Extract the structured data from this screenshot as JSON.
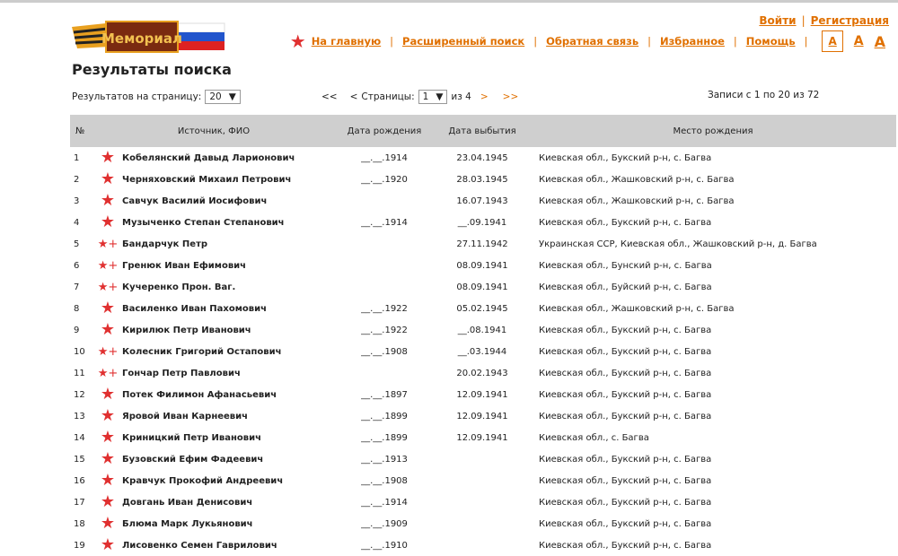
{
  "logo": {
    "text": "Мемориал"
  },
  "auth": {
    "login": "Войти",
    "register": "Регистрация"
  },
  "nav": [
    {
      "label": "На главную"
    },
    {
      "label": "Расширенный поиск"
    },
    {
      "label": "Обратная связь"
    },
    {
      "label": "Избранное"
    },
    {
      "label": "Помощь"
    }
  ],
  "font_sizes": [
    "A",
    "A",
    "A"
  ],
  "title": "Результаты поиска",
  "per_page": {
    "label": "Результатов на страницу:",
    "value": "20"
  },
  "pager": {
    "first": "<<",
    "prev": "<",
    "label": "Страницы:",
    "page": "1",
    "of": "из 4",
    "next": ">",
    "last": ">>"
  },
  "records": "Записи с 1 по 20 из 72",
  "columns": [
    "№",
    "Источник, ФИО",
    "Дата рождения",
    "Дата выбытия",
    "Место рождения"
  ],
  "rows": [
    [
      "1",
      "big",
      "Кобелянский Давыд Ларионович",
      "__.__.1914",
      "23.04.1945",
      "Киевская обл., Букский р-н, с. Багва"
    ],
    [
      "2",
      "big",
      "Черняховский Михаил Петрович",
      "__.__.1920",
      "28.03.1945",
      "Киевская обл., Жашковский р-н, с. Багва"
    ],
    [
      "3",
      "big",
      "Савчук Василий Иосифович",
      "",
      "16.07.1943",
      "Киевская обл., Жашковский р-н, с. Багва"
    ],
    [
      "4",
      "big",
      "Музыченко Степан Степанович",
      "__.__.1914",
      "__.09.1941",
      "Киевская обл., Букский р-н, с. Багва"
    ],
    [
      "5",
      "small",
      "Бандарчук Петр",
      "",
      "27.11.1942",
      "Украинская ССР, Киевская обл., Жашковский р-н, д. Багва"
    ],
    [
      "6",
      "small",
      "Гренюк Иван Ефимович",
      "",
      "08.09.1941",
      "Киевская обл., Бунский р-н, с. Багва"
    ],
    [
      "7",
      "small",
      "Кучеренко Прон. Ваг.",
      "",
      "08.09.1941",
      "Киевская обл., Буйский р-н, с. Багва"
    ],
    [
      "8",
      "big",
      "Василенко Иван Пахомович",
      "__.__.1922",
      "05.02.1945",
      "Киевская обл., Жашковский р-н, с. Багва"
    ],
    [
      "9",
      "big",
      "Кирилюк Петр Иванович",
      "__.__.1922",
      "__.08.1941",
      "Киевская обл., Букский р-н, с. Багва"
    ],
    [
      "10",
      "small",
      "Колесник Григорий Остапович",
      "__.__.1908",
      "__.03.1944",
      "Киевская обл., Букский р-н, с. Багва"
    ],
    [
      "11",
      "small",
      "Гончар Петр Павлович",
      "",
      "20.02.1943",
      "Киевская обл., Букский р-н, с. Багва"
    ],
    [
      "12",
      "big",
      "Потек Филимон Афанасьевич",
      "__.__.1897",
      "12.09.1941",
      "Киевская обл., Букский р-н, с. Багва"
    ],
    [
      "13",
      "big",
      "Яровой Иван Карнеевич",
      "__.__.1899",
      "12.09.1941",
      "Киевская обл., Букский р-н, с. Багва"
    ],
    [
      "14",
      "big",
      "Криницкий Петр Иванович",
      "__.__.1899",
      "12.09.1941",
      "Киевская обл., с. Багва"
    ],
    [
      "15",
      "big",
      "Бузовский Ефим Фадеевич",
      "__.__.1913",
      "",
      "Киевская обл., Букский р-н, с. Багва"
    ],
    [
      "16",
      "big",
      "Кравчук Прокофий Андреевич",
      "__.__.1908",
      "",
      "Киевская обл., Букский р-н, с. Багва"
    ],
    [
      "17",
      "big",
      "Довгань Иван Денисович",
      "__.__.1914",
      "",
      "Киевская обл., Букский р-н, с. Багва"
    ],
    [
      "18",
      "big",
      "Блюма Марк Лукьянович",
      "__.__.1909",
      "",
      "Киевская обл., Букский р-н, с. Багва"
    ],
    [
      "19",
      "big",
      "Лисовенко Семен Гаврилович",
      "__.__.1910",
      "",
      "Киевская обл., Букский р-н, с. Багва"
    ]
  ]
}
